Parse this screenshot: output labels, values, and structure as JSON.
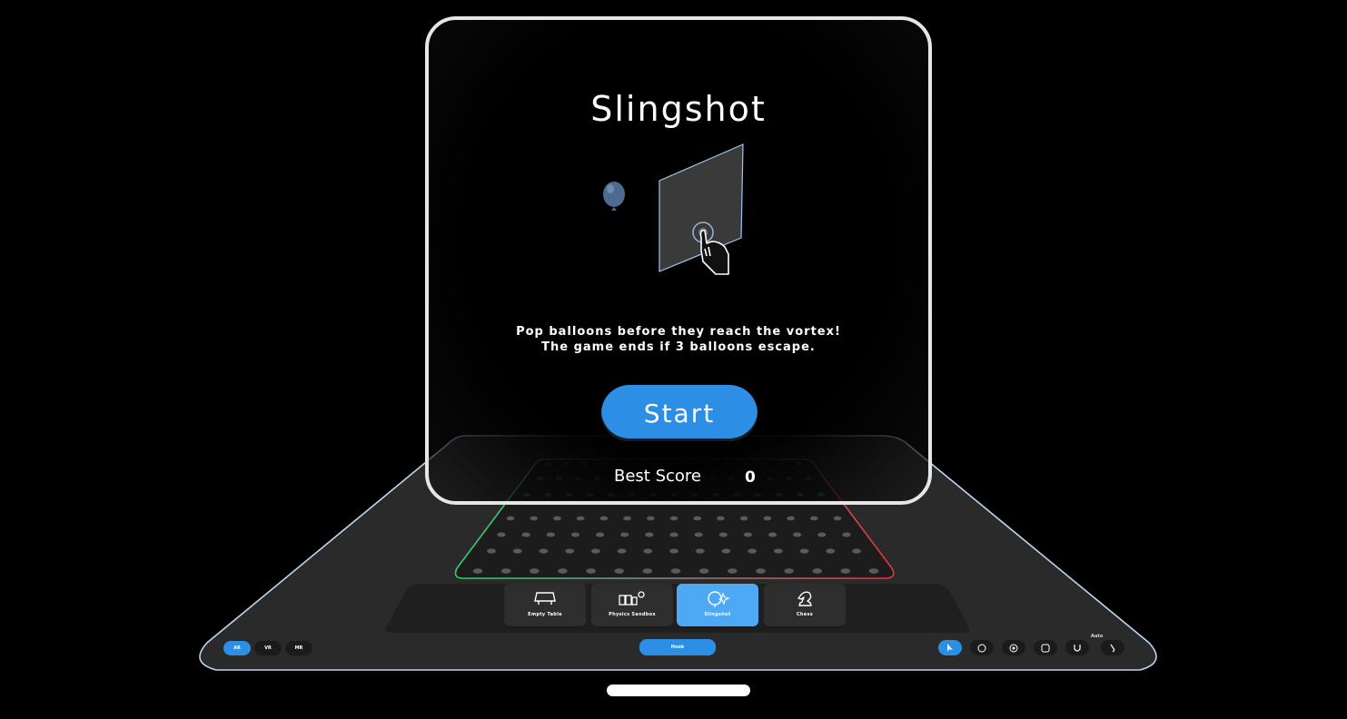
{
  "game": {
    "title": "Slingshot",
    "instructions": [
      "Pop balloons before they reach the vortex!",
      "The game ends if 3 balloons escape."
    ],
    "start_label": "Start",
    "best_score_label": "Best Score",
    "best_score_value": "0"
  },
  "modes": [
    {
      "label": "Empty Table",
      "icon": "table-icon",
      "active": false
    },
    {
      "label": "Physics Sandbox",
      "icon": "blocks-icon",
      "active": false
    },
    {
      "label": "Slingshot",
      "icon": "balloon-icon",
      "active": true
    },
    {
      "label": "Chess",
      "icon": "chess-knight-icon",
      "active": false
    }
  ],
  "left_controls": [
    "AR",
    "VR",
    "MR"
  ],
  "center_control": "Hook",
  "right_controls": [
    {
      "icon": "cursor-icon",
      "active": true
    },
    {
      "icon": "grab-icon",
      "active": false
    },
    {
      "icon": "rotate-icon",
      "active": false
    },
    {
      "icon": "settings-icon",
      "active": false
    },
    {
      "icon": "magnet-icon",
      "active": false
    },
    {
      "icon": "pin-icon",
      "active": false
    }
  ],
  "corner_label": "Auto",
  "colors": {
    "accent": "#2d8ee6",
    "active_tab": "#4ea9f5",
    "panel_border": "#e6e6e6",
    "table": "#2b2b2b"
  }
}
